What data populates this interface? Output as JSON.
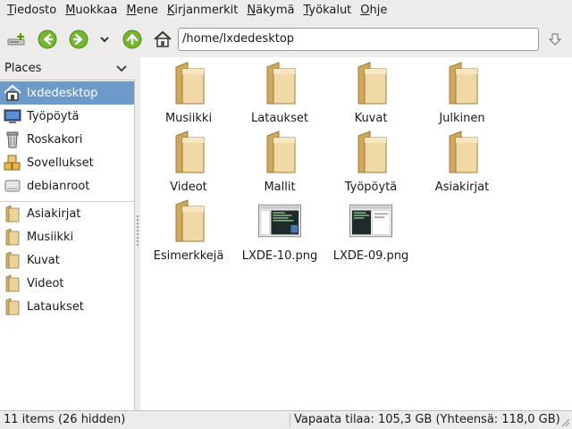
{
  "menubar": {
    "items": [
      {
        "mnemonic": "T",
        "rest": "iedosto"
      },
      {
        "mnemonic": "M",
        "rest": "uokkaa"
      },
      {
        "mnemonic": "M",
        "rest": "ene"
      },
      {
        "mnemonic": "K",
        "rest": "irjanmerkit"
      },
      {
        "mnemonic": "N",
        "rest": "äkymä"
      },
      {
        "mnemonic": "T",
        "rest": "yökalut"
      },
      {
        "mnemonic": "O",
        "rest": "hje"
      }
    ]
  },
  "toolbar": {
    "location": "/home/lxdedesktop",
    "icons": [
      "new-tab-icon",
      "back-icon",
      "forward-icon",
      "history-dropdown-icon",
      "up-icon",
      "home-icon",
      "go-icon"
    ]
  },
  "sidebar": {
    "header": "Places",
    "places": [
      {
        "label": "lxdedesktop",
        "icon": "home-icon",
        "selected": true
      },
      {
        "label": "Työpöytä",
        "icon": "desktop-icon"
      },
      {
        "label": "Roskakori",
        "icon": "trash-icon"
      },
      {
        "label": "Sovellukset",
        "icon": "applications-icon"
      },
      {
        "label": "debianroot",
        "icon": "drive-icon"
      }
    ],
    "bookmarks": [
      {
        "label": "Asiakirjat",
        "icon": "folder-icon"
      },
      {
        "label": "Musiikki",
        "icon": "folder-icon"
      },
      {
        "label": "Kuvat",
        "icon": "folder-icon"
      },
      {
        "label": "Videot",
        "icon": "folder-icon"
      },
      {
        "label": "Lataukset",
        "icon": "folder-icon"
      }
    ]
  },
  "files": [
    {
      "name": "Musiikki",
      "type": "folder"
    },
    {
      "name": "Lataukset",
      "type": "folder"
    },
    {
      "name": "Kuvat",
      "type": "folder"
    },
    {
      "name": "Julkinen",
      "type": "folder"
    },
    {
      "name": "Videot",
      "type": "folder"
    },
    {
      "name": "Mallit",
      "type": "folder"
    },
    {
      "name": "Työpöytä",
      "type": "folder"
    },
    {
      "name": "Asiakirjat",
      "type": "folder"
    },
    {
      "name": "Esimerkkejä",
      "type": "folder"
    },
    {
      "name": "LXDE-10.png",
      "type": "image"
    },
    {
      "name": "LXDE-09.png",
      "type": "image"
    }
  ],
  "statusbar": {
    "items": "11 items (26 hidden)",
    "free_space": "Vapaata tilaa: 105,3 GB (Yhteensä: 118,0 GB)"
  },
  "colors": {
    "selection": "#6d9ac8",
    "folder": "#e9cf95",
    "nav_green": "#4e9a06"
  }
}
